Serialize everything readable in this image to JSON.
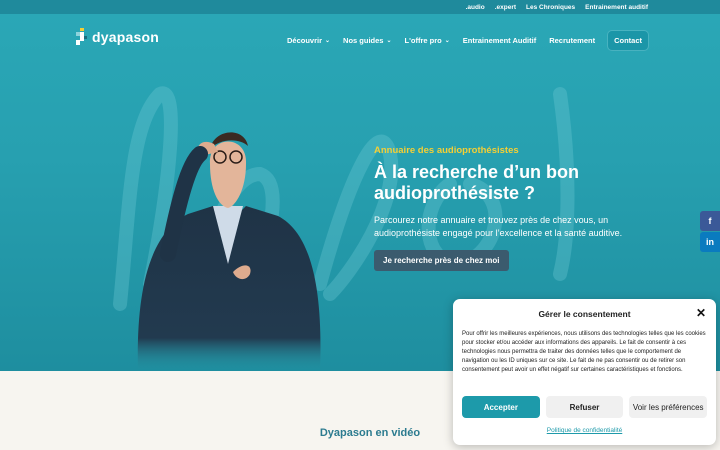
{
  "topbar": {
    "links": [
      ".audio",
      ".expert",
      "Les Chroniques",
      "Entrainement auditif"
    ]
  },
  "header": {
    "logo_text": "dyapason",
    "nav": [
      {
        "label": "Découvrir",
        "has_dropdown": true
      },
      {
        "label": "Nos guides",
        "has_dropdown": true
      },
      {
        "label": "L'offre pro",
        "has_dropdown": true
      },
      {
        "label": "Entrainement Auditif",
        "has_dropdown": false
      },
      {
        "label": "Recrutement",
        "has_dropdown": false
      }
    ],
    "contact_label": "Contact"
  },
  "hero": {
    "kicker": "Annuaire des audioprothésistes",
    "title": "À la recherche d’un bon audioprothésiste ?",
    "description": "Parcourez notre annuaire et trouvez près de chez vous, un audioprothésiste engagé pour l’excellence et la santé auditive.",
    "cta_label": "Je recherche près de chez moi"
  },
  "social": {
    "facebook_glyph": "f",
    "linkedin_glyph": "in"
  },
  "section": {
    "video_title": "Dyapason en vidéo"
  },
  "consent": {
    "title": "Gérer le consentement",
    "text": "Pour offrir les meilleures expériences, nous utilisons des technologies telles que les cookies pour stocker et/ou accéder aux informations des appareils. Le fait de consentir à ces technologies nous permettra de traiter des données telles que le comportement de navigation ou les ID uniques sur ce site. Le fait de ne pas consentir ou de retirer son consentement peut avoir un effet négatif sur certaines caractéristiques et fonctions.",
    "accept_label": "Accepter",
    "refuse_label": "Refuser",
    "prefs_label": "Voir les préférences",
    "policy_label": "Politique de confidentialité",
    "close_glyph": "✕"
  },
  "colors": {
    "hero_teal": "#27a0b0",
    "topbar_teal": "#1f8a9c",
    "accent_yellow": "#f4cf35",
    "cta_slate": "#3b5b6e",
    "consent_accent": "#1d9aaa",
    "page_cream": "#f7f5f0"
  },
  "icons": [
    "dyapason-logo-icon",
    "chevron-down-icon",
    "facebook-icon",
    "linkedin-icon",
    "close-icon"
  ]
}
